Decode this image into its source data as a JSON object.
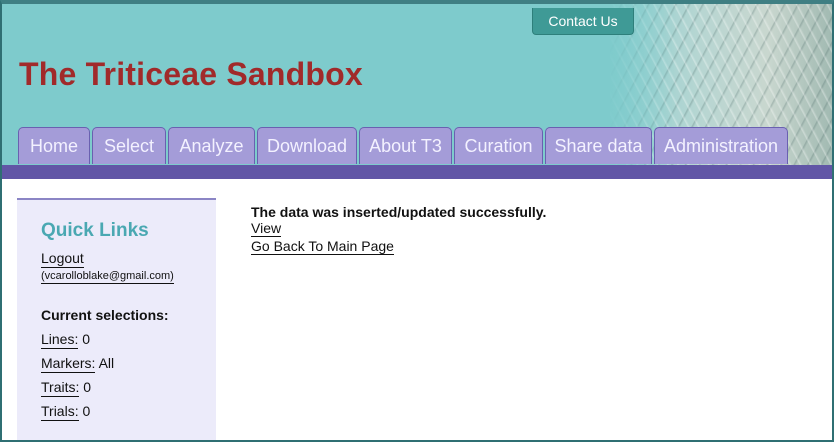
{
  "header": {
    "contact_label": "Contact Us",
    "site_title": "The Triticeae Sandbox",
    "colors": {
      "header_bg": "#7ecbcc",
      "title": "#a12a2a",
      "tab_bg": "#a49cd8",
      "nav_bar": "#6156a6"
    }
  },
  "nav": {
    "tabs": [
      {
        "label": "Home"
      },
      {
        "label": "Select"
      },
      {
        "label": "Analyze"
      },
      {
        "label": "Download"
      },
      {
        "label": "About T3"
      },
      {
        "label": "Curation"
      },
      {
        "label": "Share data"
      },
      {
        "label": "Administration"
      }
    ]
  },
  "sidebar": {
    "title": "Quick Links",
    "logout_label": "Logout",
    "email": "(vcarolloblake@gmail.com)",
    "current_title": "Current selections:",
    "selections": [
      {
        "label": "Lines:",
        "value": "0"
      },
      {
        "label": "Markers:",
        "value": "All"
      },
      {
        "label": "Traits:",
        "value": "0"
      },
      {
        "label": "Trials:",
        "value": "0"
      }
    ]
  },
  "main": {
    "message": "The data was inserted/updated successfully.",
    "view_label": "View",
    "back_label": "Go Back To Main Page"
  }
}
